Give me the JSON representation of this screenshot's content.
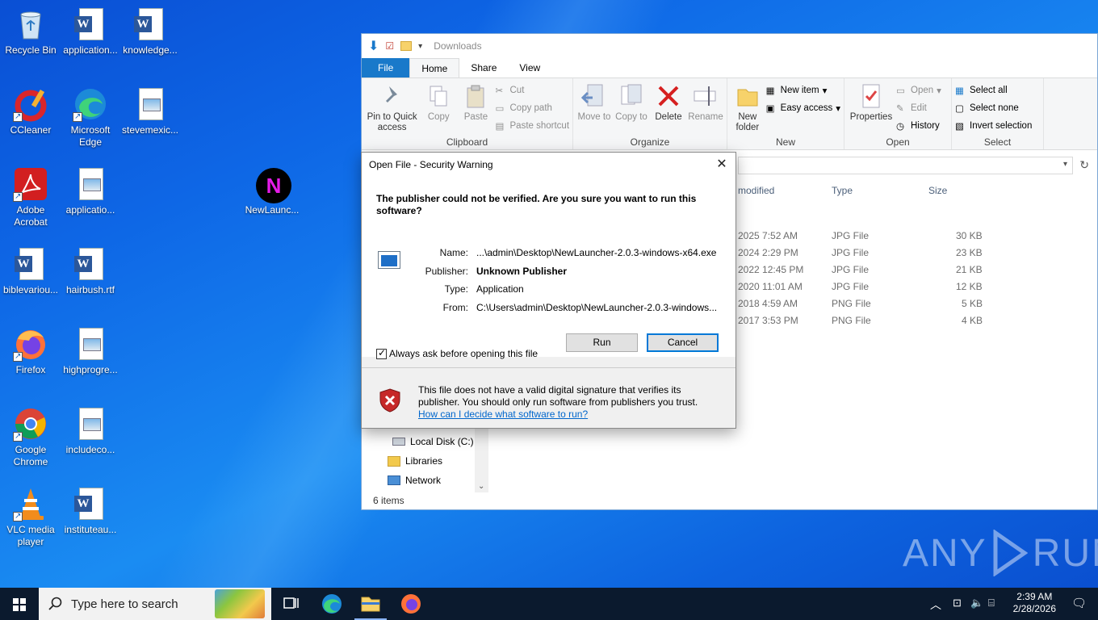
{
  "desktop": {
    "icons": [
      {
        "label": "Recycle Bin"
      },
      {
        "label": "application..."
      },
      {
        "label": "knowledge..."
      },
      {
        "label": "CCleaner"
      },
      {
        "label": "Microsoft Edge"
      },
      {
        "label": "stevemexic..."
      },
      {
        "label": "Adobe Acrobat"
      },
      {
        "label": "applicatio..."
      },
      {
        "label": "NewLaunc..."
      },
      {
        "label": "biblevariou..."
      },
      {
        "label": "hairbush.rtf"
      },
      {
        "label": "Firefox"
      },
      {
        "label": "highprogre..."
      },
      {
        "label": "Google Chrome"
      },
      {
        "label": "includeco..."
      },
      {
        "label": "VLC media player"
      },
      {
        "label": "instituteau..."
      }
    ]
  },
  "explorer": {
    "title": "Downloads",
    "tabs": [
      "File",
      "Home",
      "Share",
      "View"
    ],
    "ribbon": {
      "clipboard": {
        "label": "Clipboard",
        "pin": "Pin to Quick access",
        "copy": "Copy",
        "paste": "Paste",
        "cut": "Cut",
        "copy_path": "Copy path",
        "paste_shortcut": "Paste shortcut"
      },
      "organize": {
        "label": "Organize",
        "move_to": "Move to",
        "copy_to": "Copy to",
        "delete": "Delete",
        "rename": "Rename"
      },
      "new": {
        "label": "New",
        "new_folder": "New folder",
        "new_item": "New item",
        "easy_access": "Easy access"
      },
      "open": {
        "label": "Open",
        "properties": "Properties",
        "open": "Open",
        "edit": "Edit",
        "history": "History"
      },
      "select": {
        "label": "Select",
        "select_all": "Select all",
        "select_none": "Select none",
        "invert": "Invert selection"
      }
    },
    "columns": {
      "modified": "modified",
      "type": "Type",
      "size": "Size"
    },
    "rows": [
      {
        "date": "2025 7:52 AM",
        "type": "JPG File",
        "size": "30 KB"
      },
      {
        "date": "2024 2:29 PM",
        "type": "JPG File",
        "size": "23 KB"
      },
      {
        "date": "2022 12:45 PM",
        "type": "JPG File",
        "size": "21 KB"
      },
      {
        "date": "2020 11:01 AM",
        "type": "JPG File",
        "size": "12 KB"
      },
      {
        "date": "2018 4:59 AM",
        "type": "PNG File",
        "size": "5 KB"
      },
      {
        "date": "2017 3:53 PM",
        "type": "PNG File",
        "size": "4 KB"
      }
    ],
    "nav": {
      "local_disk": "Local Disk (C:)",
      "libraries": "Libraries",
      "network": "Network"
    },
    "status": "6 items"
  },
  "dialog": {
    "title": "Open File - Security Warning",
    "heading": "The publisher could not be verified.  Are you sure you want to run this software?",
    "name_label": "Name:",
    "name_value": "...\\admin\\Desktop\\NewLauncher-2.0.3-windows-x64.exe",
    "publisher_label": "Publisher:",
    "publisher_value": "Unknown Publisher",
    "type_label": "Type:",
    "type_value": "Application",
    "from_label": "From:",
    "from_value": "C:\\Users\\admin\\Desktop\\NewLauncher-2.0.3-windows...",
    "run": "Run",
    "cancel": "Cancel",
    "checkbox": "Always ask before opening this file",
    "warning": "This file does not have a valid digital signature that verifies its publisher.  You should only run software from publishers you trust.",
    "link": "How can I decide what software to run?"
  },
  "taskbar": {
    "search_placeholder": "Type here to search",
    "time": "2:39 AM",
    "date": "2/28/2026"
  },
  "watermark": {
    "left": "ANY",
    "right": "RUN"
  }
}
